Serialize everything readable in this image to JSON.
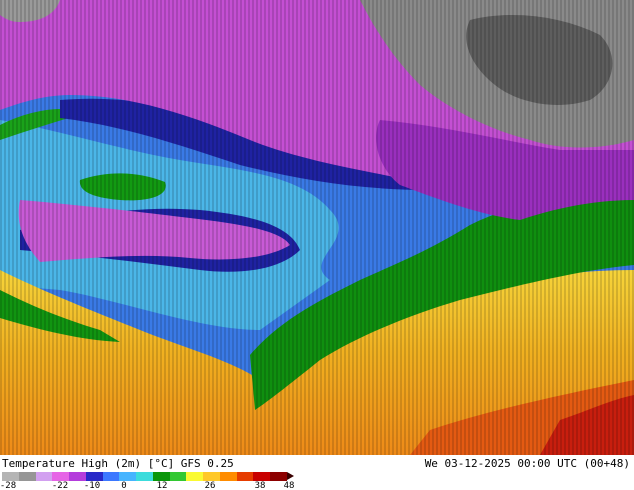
{
  "map": {
    "title": "Temperature High (2m) [°C] GFS 0.25",
    "valid_time": "We 03-12-2025 00:00 UTC (00+48)"
  },
  "colorbar": {
    "ticks": [
      "-28",
      "-22",
      "-10",
      "0",
      "12",
      "26",
      "38",
      "48"
    ],
    "colors": [
      "#b4b4b4",
      "#969696",
      "#d2a0f0",
      "#e664e6",
      "#b43cdc",
      "#2828c8",
      "#3c78ff",
      "#46b4ff",
      "#3cdcdc",
      "#0a960a",
      "#32c832",
      "#fafa32",
      "#ffc828",
      "#ff8c00",
      "#e63c00",
      "#c80000",
      "#8c0000"
    ]
  },
  "palette": {
    "gray_dark": "#6e6e6e",
    "gray_light": "#a0a0a0",
    "magenta": "#c850d2",
    "purple": "#9b2bbf",
    "navy": "#1e1e9c",
    "blue": "#2f5fe0",
    "cyan": "#47b8e6",
    "green": "#0c8c0c",
    "yellow": "#f0c828",
    "orange": "#f09a1c",
    "red": "#d22814"
  }
}
